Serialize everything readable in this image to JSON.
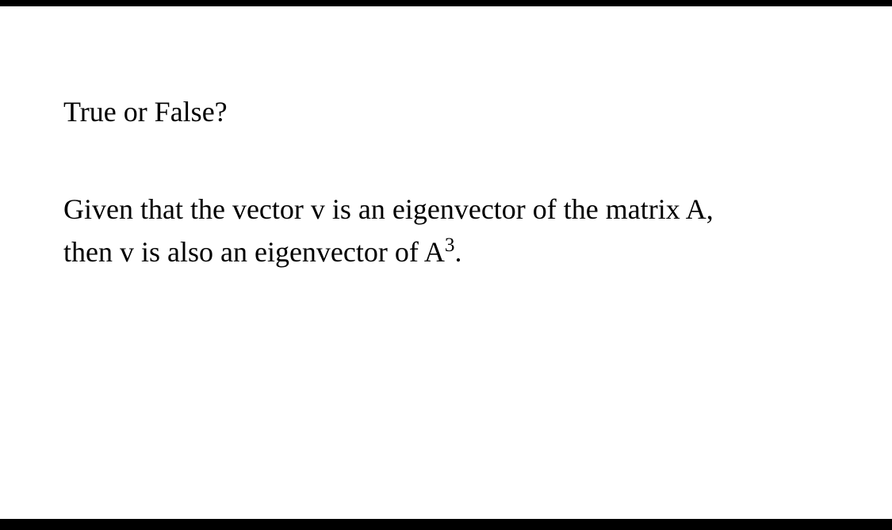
{
  "question": {
    "header": "True or False?",
    "line1": "Given that the vector v is an eigenvector of the matrix A,",
    "line2_prefix": "then v is also an eigenvector of A",
    "exponent": "3",
    "line2_suffix": "."
  }
}
